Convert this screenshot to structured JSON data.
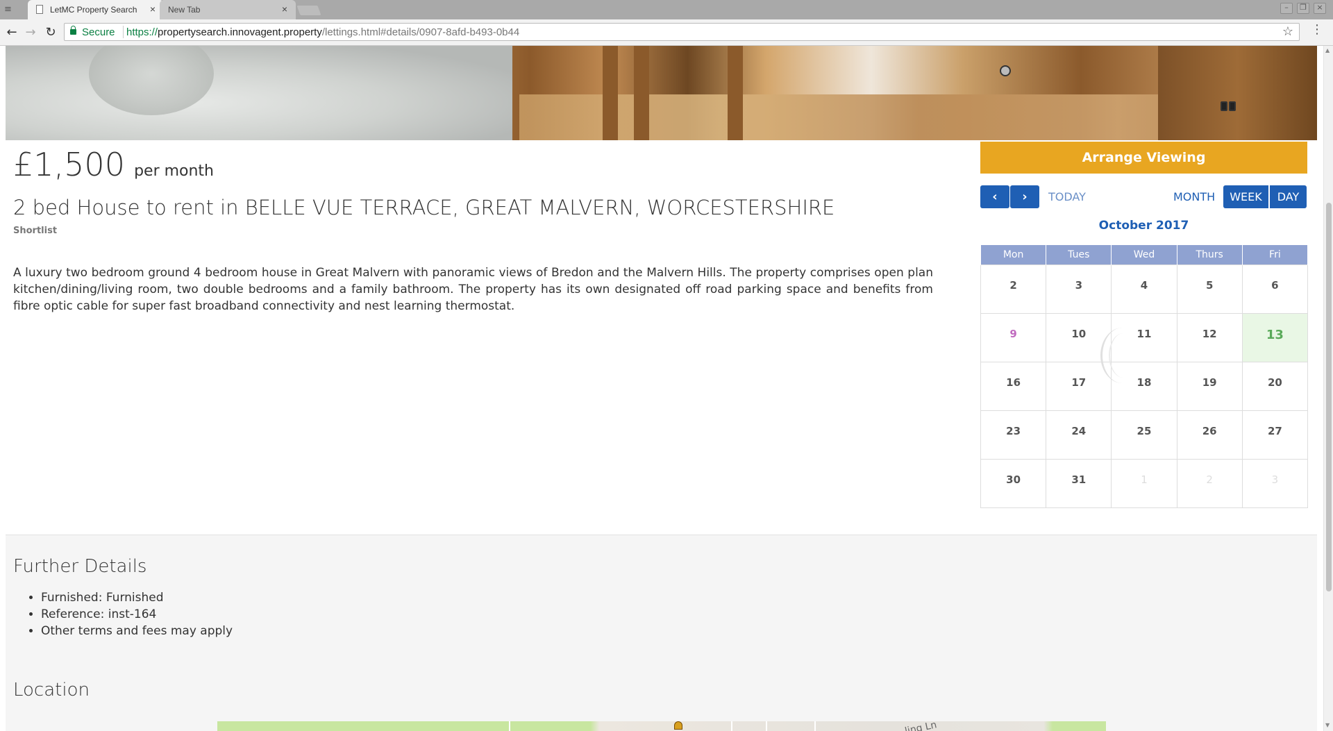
{
  "browser": {
    "tabs": [
      {
        "title": "LetMC Property Search",
        "active": true
      },
      {
        "title": "New Tab",
        "active": false
      }
    ],
    "secure_label": "Secure",
    "url_scheme": "https://",
    "url_host": "propertysearch.innovagent.property",
    "url_path": "/lettings.html#details/0907-8afd-b493-0b44"
  },
  "listing": {
    "price": "£1,500",
    "period": "per month",
    "title": "2 bed House to rent in BELLE VUE TERRACE, GREAT MALVERN, WORCESTERSHIRE",
    "shortlist_label": "Shortlist",
    "description": "A luxury two bedroom ground 4 bedroom house in Great Malvern with panoramic views of Bredon and the Malvern Hills. The property comprises open plan kitchen/dining/living room, two double bedrooms and a family bathroom. The property has its own designated off road parking space and benefits from fibre optic cable for super fast broadband connectivity and nest learning thermostat."
  },
  "viewing": {
    "arrange_label": "Arrange Viewing",
    "prev_label": "‹",
    "next_label": "›",
    "today_label": "TODAY",
    "month_label": "MONTH",
    "week_label": "WEEK",
    "day_label": "DAY",
    "heading": "October 2017",
    "weekdays": [
      "Mon",
      "Tues",
      "Wed",
      "Thurs",
      "Fri"
    ],
    "weeks": [
      [
        "2",
        "3",
        "4",
        "5",
        "6"
      ],
      [
        "9",
        "10",
        "11",
        "12",
        "13"
      ],
      [
        "16",
        "17",
        "18",
        "19",
        "20"
      ],
      [
        "23",
        "24",
        "25",
        "26",
        "27"
      ],
      [
        "30",
        "31",
        "1",
        "2",
        "3"
      ]
    ],
    "colors": {
      "accent": "#e8a621",
      "primary": "#1f5fb4",
      "header": "#8fa2d1",
      "selected": "#5aaa5a"
    }
  },
  "further": {
    "heading": "Further Details",
    "items": [
      "Furnished: Furnished",
      "Reference: inst-164",
      "Other terms and fees may apply"
    ]
  },
  "location": {
    "heading": "Location",
    "map_label": "ling Ln"
  }
}
